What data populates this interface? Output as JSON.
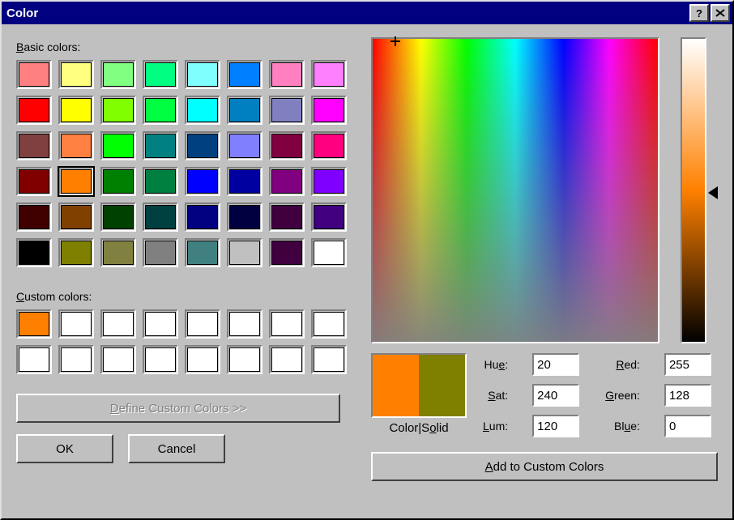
{
  "title": "Color",
  "labels": {
    "basic_prefix": "B",
    "basic_rest": "asic colors:",
    "custom_prefix": "C",
    "custom_rest": "ustom colors:",
    "define_prefix": "D",
    "define_rest": "efine Custom Colors >>",
    "ok": "OK",
    "cancel": "Cancel",
    "color_solid_left": "Color|S",
    "color_solid_underline": "o",
    "color_solid_right": "lid",
    "hue_prefix": "Hu",
    "hue_underline": "e",
    "hue_suffix": ":",
    "sat_prefix": "",
    "sat_underline": "S",
    "sat_suffix": "at:",
    "lum_prefix": "",
    "lum_underline": "L",
    "lum_suffix": "um:",
    "red_prefix": "",
    "red_underline": "R",
    "red_suffix": "ed:",
    "green_prefix": "",
    "green_underline": "G",
    "green_suffix": "reen:",
    "blue_prefix": "Bl",
    "blue_underline": "u",
    "blue_suffix": "e:",
    "add_prefix": "",
    "add_underline": "A",
    "add_suffix": "dd to Custom Colors"
  },
  "values": {
    "hue": "20",
    "sat": "240",
    "lum": "120",
    "red": "255",
    "green": "128",
    "blue": "0"
  },
  "basic_colors": [
    "#ff8080",
    "#ffff80",
    "#80ff80",
    "#00ff80",
    "#80ffff",
    "#0080ff",
    "#ff80c0",
    "#ff80ff",
    "#ff0000",
    "#ffff00",
    "#80ff00",
    "#00ff40",
    "#00ffff",
    "#0080c0",
    "#8080c0",
    "#ff00ff",
    "#804040",
    "#ff8040",
    "#00ff00",
    "#008080",
    "#004080",
    "#8080ff",
    "#800040",
    "#ff0080",
    "#800000",
    "#ff8000",
    "#008000",
    "#008040",
    "#0000ff",
    "#0000a0",
    "#800080",
    "#8000ff",
    "#400000",
    "#804000",
    "#004000",
    "#004040",
    "#000080",
    "#000040",
    "#400040",
    "#400080",
    "#000000",
    "#808000",
    "#808040",
    "#808080",
    "#408080",
    "#c0c0c0",
    "#400040",
    "#ffffff"
  ],
  "selected_basic_index": 25,
  "custom_colors": [
    "#ff8000",
    "#ffffff",
    "#ffffff",
    "#ffffff",
    "#ffffff",
    "#ffffff",
    "#ffffff",
    "#ffffff",
    "#ffffff",
    "#ffffff",
    "#ffffff",
    "#ffffff",
    "#ffffff",
    "#ffffff",
    "#ffffff",
    "#ffffff"
  ],
  "preview": {
    "color": "#ff8000",
    "solid": "#808000"
  }
}
